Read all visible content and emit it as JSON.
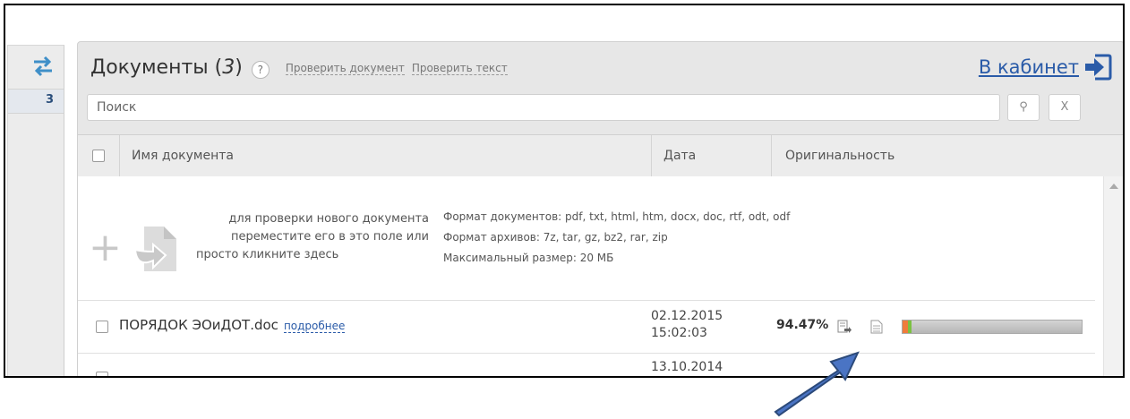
{
  "sidebar": {
    "count": "3"
  },
  "header": {
    "title": "Документы",
    "count": "3",
    "help": "?",
    "link_check_document": "Проверить документ",
    "link_check_text": "Проверить текст",
    "cabinet": "В кабинет"
  },
  "search": {
    "placeholder": "Поиск",
    "search_glyph": "⚲",
    "clear_label": "X"
  },
  "table": {
    "columns": {
      "name": "Имя документа",
      "date": "Дата",
      "originality": "Оригинальность"
    }
  },
  "upload": {
    "line1": "для проверки нового документа",
    "line2": "переместите его в это поле или",
    "line3": "просто кликните здесь",
    "formats": "Формат документов: pdf, txt, html, htm, docx, doc, rtf, odt, odf",
    "archives": "Формат архивов: 7z, tar, gz, bz2, rar, zip",
    "max_size": "Максимальный размер: 20 МБ"
  },
  "rows": [
    {
      "name": "ПОРЯДОК ЭОиДОТ.doc",
      "more": "подробнее",
      "date": "02.12.2015",
      "time": "15:02:03",
      "originality": "94.47%",
      "originality_fraction": 0.9447,
      "borrowed_fraction": 0.03,
      "citation_fraction": 0.02
    },
    {
      "date": "13.10.2014"
    }
  ],
  "colors": {
    "link": "#2a5ba8",
    "annotation_arrow": "#4a74c4",
    "borrowed": "#ef7c3c",
    "citation": "#7bc142"
  }
}
